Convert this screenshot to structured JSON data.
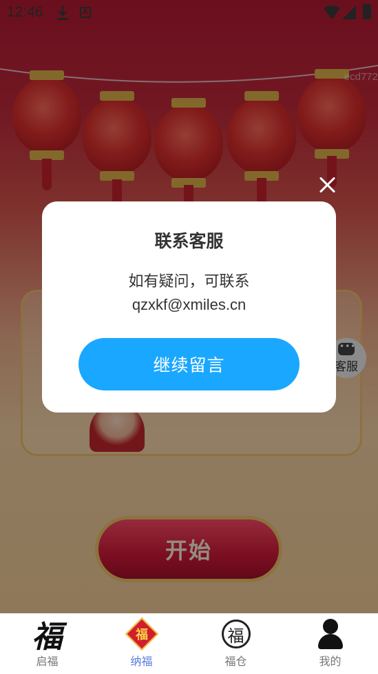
{
  "status_bar": {
    "time": "12:46",
    "icons": [
      "download-icon",
      "a-box-icon",
      "wifi-icon",
      "signal-icon",
      "battery-icon"
    ]
  },
  "background": {
    "watermark": "ecd772",
    "floating_service_label": "客服",
    "start_button_label": "开始"
  },
  "dialog": {
    "title": "联系客服",
    "line1": "如有疑问，可联系",
    "line2": "qzxkf@xmiles.cn",
    "button_label": "继续留言",
    "button_color": "#1aa7ff"
  },
  "bottom_nav": {
    "active_color": "#5a7be0",
    "items": [
      {
        "label": "启福",
        "icon": "fu-calligraphy-icon",
        "glyph": "福"
      },
      {
        "label": "纳福",
        "icon": "fu-diamond-icon",
        "glyph": "福",
        "active": true
      },
      {
        "label": "福仓",
        "icon": "fu-circle-icon",
        "glyph": "福"
      },
      {
        "label": "我的",
        "icon": "person-icon"
      }
    ]
  }
}
